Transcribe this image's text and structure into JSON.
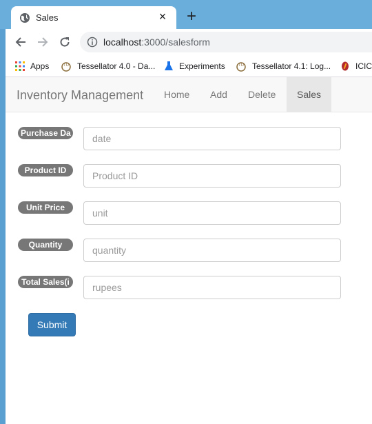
{
  "browser": {
    "tab": {
      "title": "Sales",
      "close": "×"
    },
    "new_tab": "+",
    "url_host": "localhost",
    "url_rest": ":3000/salesform",
    "bookmarks": [
      {
        "label": "Apps",
        "icon": "apps-grid-icon"
      },
      {
        "label": "Tessellator 4.0 - Da...",
        "icon": "tessellator-icon"
      },
      {
        "label": "Experiments",
        "icon": "flask-icon"
      },
      {
        "label": "Tessellator 4.1: Log...",
        "icon": "tessellator-icon"
      },
      {
        "label": "ICIC",
        "icon": "icici-icon"
      }
    ]
  },
  "navbar": {
    "brand": "Inventory Management",
    "links": [
      {
        "label": "Home"
      },
      {
        "label": "Add"
      },
      {
        "label": "Delete"
      },
      {
        "label": "Sales",
        "active": true
      }
    ]
  },
  "form": {
    "fields": [
      {
        "label": "Purchase Da",
        "placeholder": "date"
      },
      {
        "label": "Product ID",
        "placeholder": "Product ID"
      },
      {
        "label": "Unit Price",
        "placeholder": "unit"
      },
      {
        "label": "Quantity",
        "placeholder": "quantity"
      },
      {
        "label": "Total Sales(i",
        "placeholder": "rupees"
      }
    ],
    "submit_label": "Submit"
  },
  "colors": {
    "submit": "#337ab7",
    "label_badge": "#777777",
    "tab_strip": "#6aaedb"
  }
}
